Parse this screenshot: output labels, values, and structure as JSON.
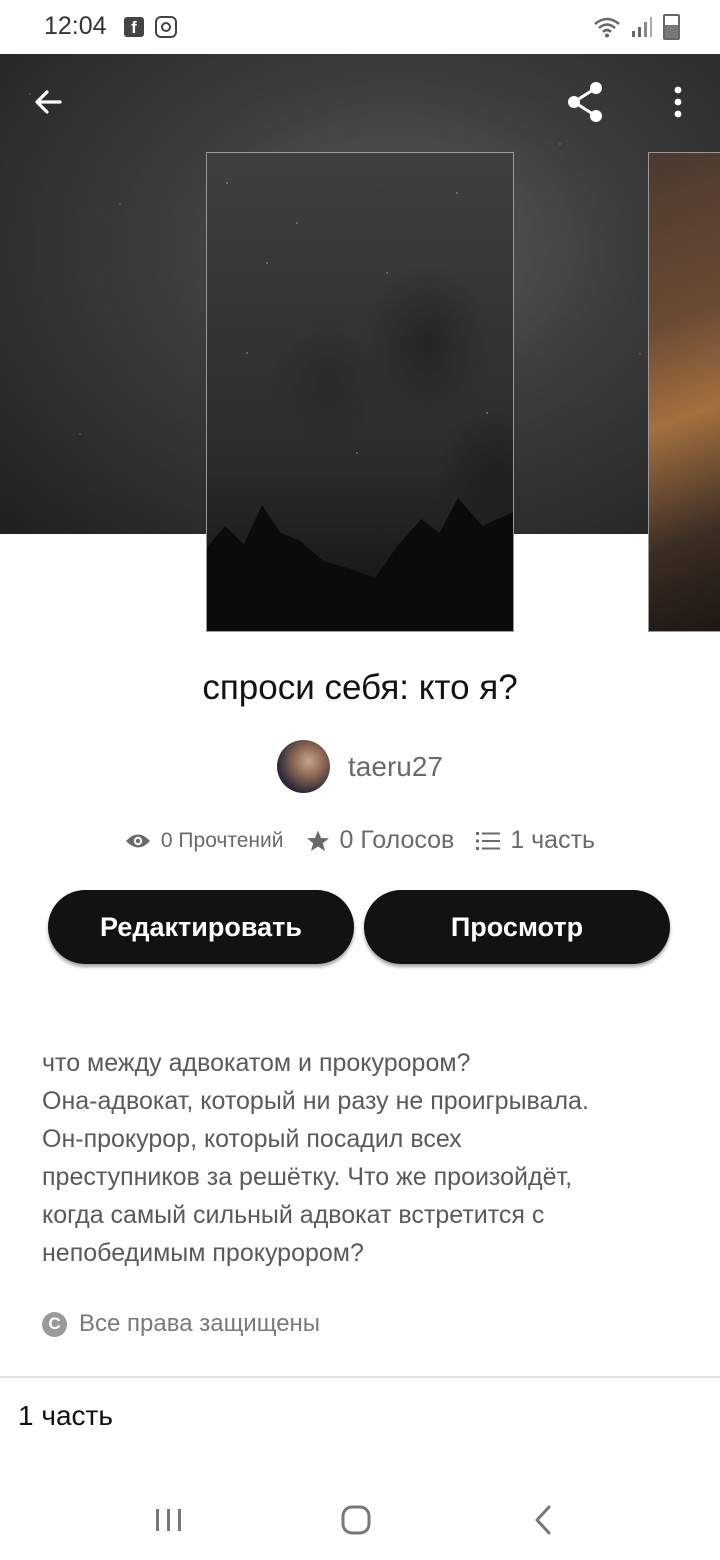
{
  "status_bar": {
    "time": "12:04",
    "icons": [
      "facebook-icon",
      "instagram-icon",
      "wifi-icon",
      "signal-icon",
      "battery-icon"
    ]
  },
  "toolbar": {
    "back_icon": "arrow-left-icon",
    "share_icon": "share-icon",
    "more_icon": "more-vertical-icon"
  },
  "story": {
    "title": "спроси себя: кто я?",
    "author": "taeru27",
    "stats": {
      "reads": "0 Прочтений",
      "votes": "0 Голосов",
      "parts": "1 часть"
    },
    "buttons": {
      "edit": "Редактировать",
      "view": "Просмотр"
    },
    "description": [
      "что между адвокатом и прокурором?",
      "Она-адвокат, который ни разу не проигрывала.",
      "Он-прокурор, который посадил всех",
      "преступников за решётку. Что же произойдёт,",
      "когда самый сильный адвокат встретится с",
      "непобедимым прокурором?"
    ],
    "copyright": "Все права защищены",
    "parts_header": "1 часть"
  },
  "colors": {
    "button_bg": "#121212",
    "text_muted": "#6a6a6a"
  }
}
